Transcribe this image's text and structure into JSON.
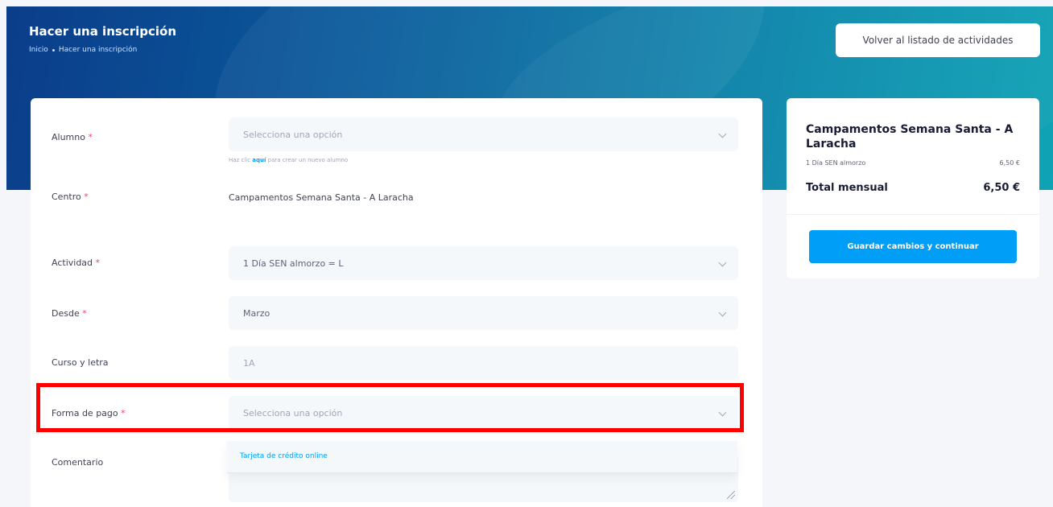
{
  "header": {
    "title": "Hacer una inscripción",
    "breadcrumb": [
      "Inicio",
      "Hacer una inscripción"
    ],
    "back_button": "Volver al listado de actividades"
  },
  "form": {
    "alumno": {
      "label": "Alumno",
      "required": "*",
      "placeholder": "Selecciona una opción",
      "hint_prefix": "Haz clic",
      "hint_link": "aquí",
      "hint_suffix": "para crear un nuevo alumno"
    },
    "centro": {
      "label": "Centro",
      "required": "*",
      "value": "Campamentos Semana Santa - A Laracha"
    },
    "actividad": {
      "label": "Actividad",
      "required": "*",
      "value": "1 Día SEN almorzo = L"
    },
    "desde": {
      "label": "Desde",
      "required": "*",
      "value": "Marzo"
    },
    "curso": {
      "label": "Curso y letra",
      "value": "1A"
    },
    "forma_pago": {
      "label": "Forma de pago",
      "required": "*",
      "placeholder": "Selecciona una opción",
      "options": [
        "Tarjeta de crédito online"
      ]
    },
    "comentario": {
      "label": "Comentario"
    }
  },
  "summary": {
    "title": "Campamentos Semana Santa - A Laracha",
    "line_item": {
      "name": "1 Día SEN almorzo",
      "price": "6,50 €"
    },
    "total_label": "Total mensual",
    "total_value": "6,50 €",
    "save_button": "Guardar cambios y continuar"
  },
  "colors": {
    "primary": "#009ef7",
    "highlight": "#ff0000",
    "required": "#f1416c"
  }
}
